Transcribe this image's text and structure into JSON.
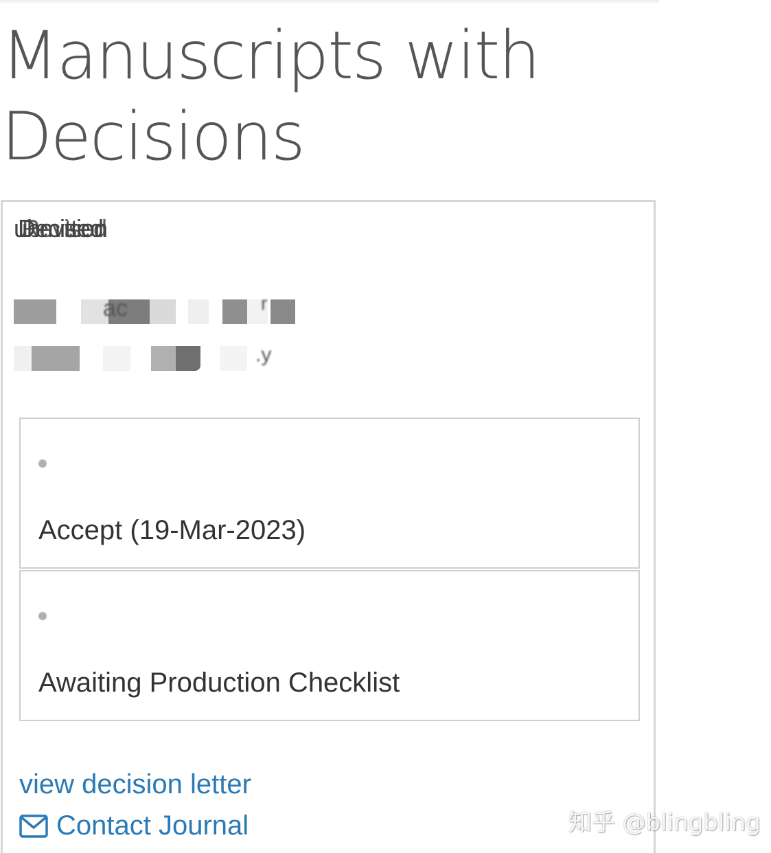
{
  "page": {
    "title": "Manuscripts with Decisions"
  },
  "manuscript": {
    "status_overlaps": [
      "ubmitted",
      "Decision",
      "Revised"
    ],
    "redacted_title_fragment_a": "ac",
    "redacted_title_fragment_b": "r",
    "redacted_line2_fragment": ".y"
  },
  "status_history": [
    {
      "text": "Accept (19-Mar-2023)"
    },
    {
      "text": "Awaiting Production Checklist"
    }
  ],
  "actions": {
    "view_decision_letter": "view decision letter",
    "contact_journal": "Contact Journal"
  },
  "icons": {
    "contact": "envelope-icon",
    "bullet": "status-dot-icon"
  },
  "colors": {
    "link": "#2a7ab6",
    "title": "#555555",
    "border": "#d6d6d6"
  },
  "watermark": {
    "text": "知乎 @blingbling"
  }
}
